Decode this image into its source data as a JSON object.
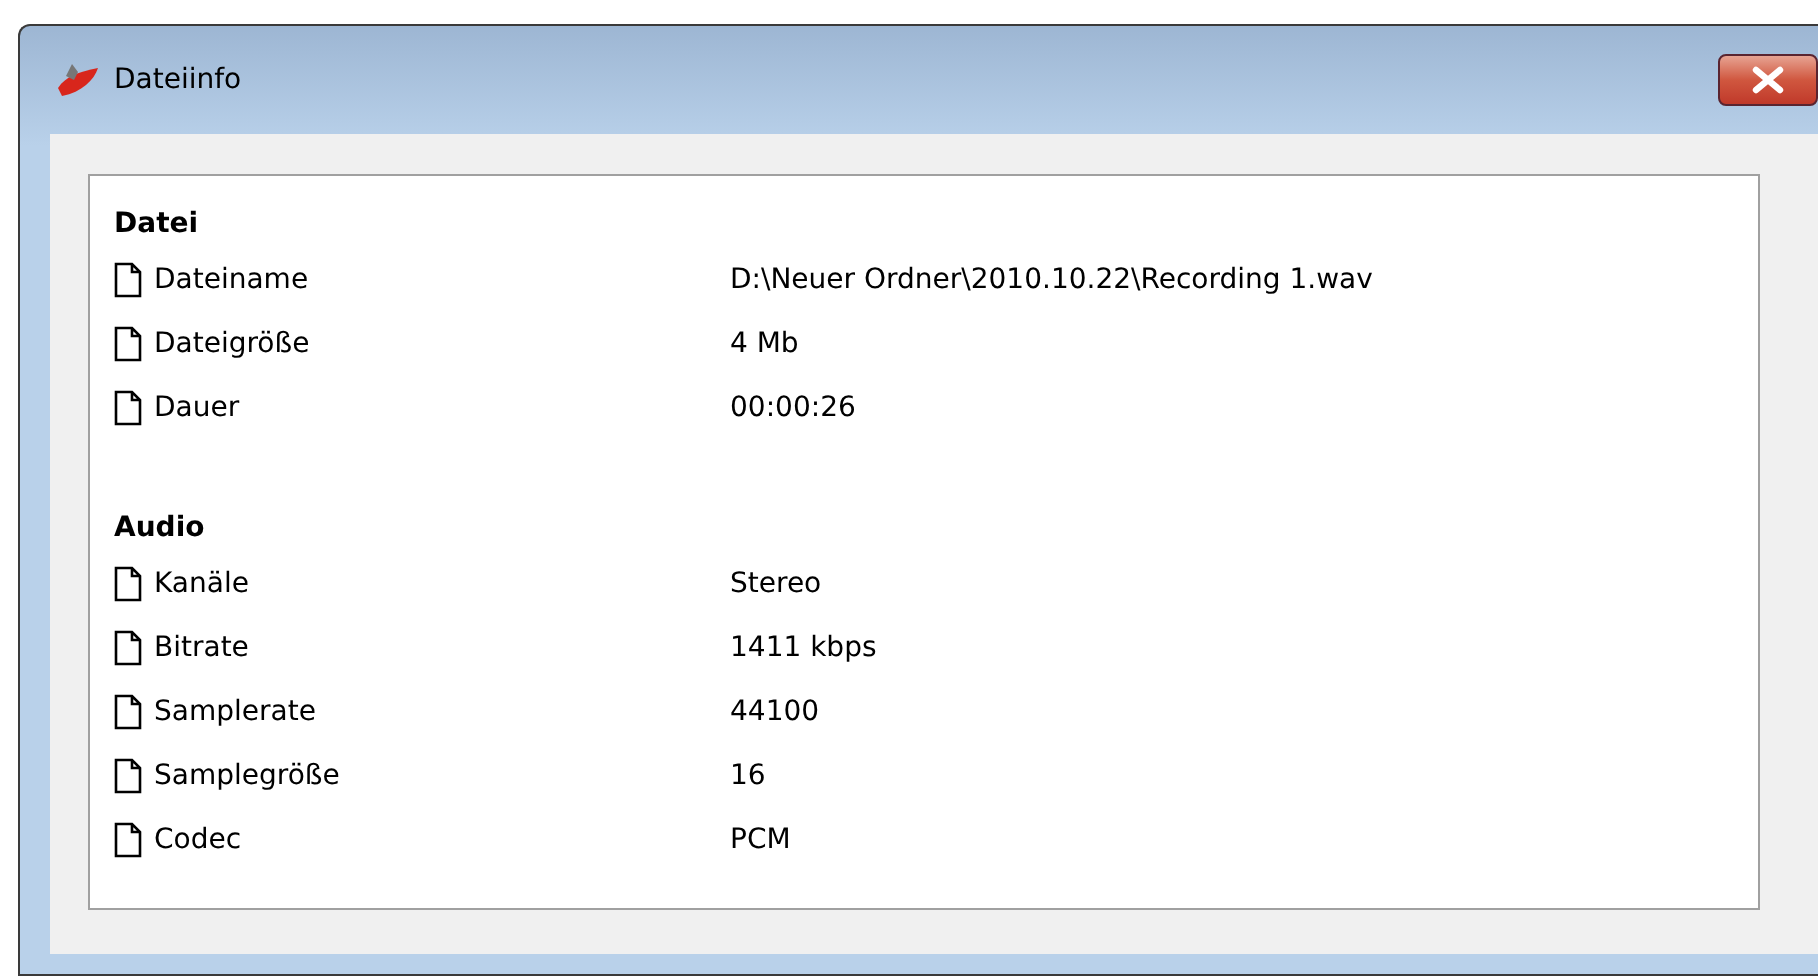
{
  "window": {
    "title": "Dateiinfo"
  },
  "sections": [
    {
      "title": "Datei",
      "rows": [
        {
          "label": "Dateiname",
          "value": "D:\\Neuer Ordner\\2010.10.22\\Recording 1.wav"
        },
        {
          "label": "Dateigröße",
          "value": "4 Mb"
        },
        {
          "label": "Dauer",
          "value": "00:00:26"
        }
      ]
    },
    {
      "title": "Audio",
      "rows": [
        {
          "label": "Kanäle",
          "value": "Stereo"
        },
        {
          "label": "Bitrate",
          "value": "1411 kbps"
        },
        {
          "label": "Samplerate",
          "value": "44100"
        },
        {
          "label": "Samplegröße",
          "value": "16"
        },
        {
          "label": "Codec",
          "value": "PCM"
        }
      ]
    }
  ]
}
